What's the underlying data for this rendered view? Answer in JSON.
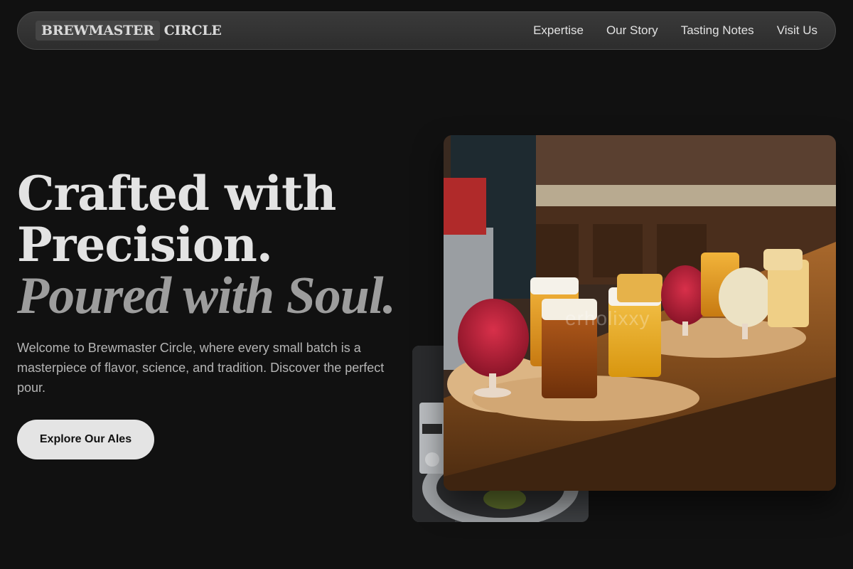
{
  "brand": {
    "word1": "BREWMASTER",
    "word2": "CIRCLE"
  },
  "nav": {
    "links": [
      "Expertise",
      "Our Story",
      "Tasting Notes",
      "Visit Us"
    ]
  },
  "hero": {
    "title_line1": "Crafted with",
    "title_line2": "Precision.",
    "title_line3": "Poured with Soul.",
    "description": "Welcome to Brewmaster Circle, where every small batch is a masterpiece of flavor, science, and tradition. Discover the perfect pour.",
    "cta_label": "Explore Our Ales"
  },
  "images": {
    "main_icon": "beer-flight-photo",
    "secondary_icon": "brewing-equipment-photo",
    "watermark_text": "erholixxy"
  },
  "colors": {
    "background": "#111111",
    "nav_bg": "#333333",
    "cta_bg": "#e4e4e4",
    "title": "#e3e3e3",
    "title_accent": "#9d9d9d"
  }
}
